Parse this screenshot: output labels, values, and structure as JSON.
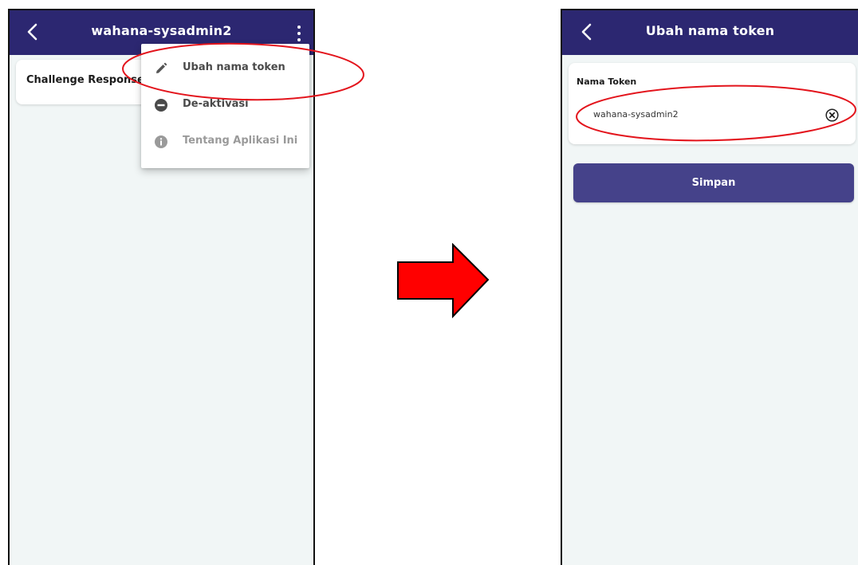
{
  "left_screen": {
    "appbar": {
      "title": "wahana-sysadmin2",
      "back_icon": "chevron-left-icon",
      "more_icon": "more-vertical-icon"
    },
    "card": {
      "label": "Challenge Response"
    },
    "menu": {
      "items": [
        {
          "label": "Ubah nama token",
          "icon": "pencil-icon"
        },
        {
          "label": "De-aktivasi",
          "icon": "minus-circle-icon"
        },
        {
          "label": "Tentang Aplikasi Ini",
          "icon": "info-circle-icon"
        }
      ]
    }
  },
  "right_screen": {
    "appbar": {
      "title": "Ubah nama token",
      "back_icon": "chevron-left-icon"
    },
    "field": {
      "label": "Nama Token",
      "value": "wahana-sysadmin2",
      "clear_icon": "clear-circle-icon"
    },
    "save_button": {
      "label": "Simpan"
    }
  },
  "colors": {
    "appbar": "#2c2771",
    "background": "#f1f6f6",
    "button": "#45428a",
    "highlight_ellipse": "#e3141c",
    "arrow": "#ff0000"
  },
  "annotations": {
    "arrow_icon": "right-arrow-icon",
    "highlight": "ellipse-highlight"
  }
}
